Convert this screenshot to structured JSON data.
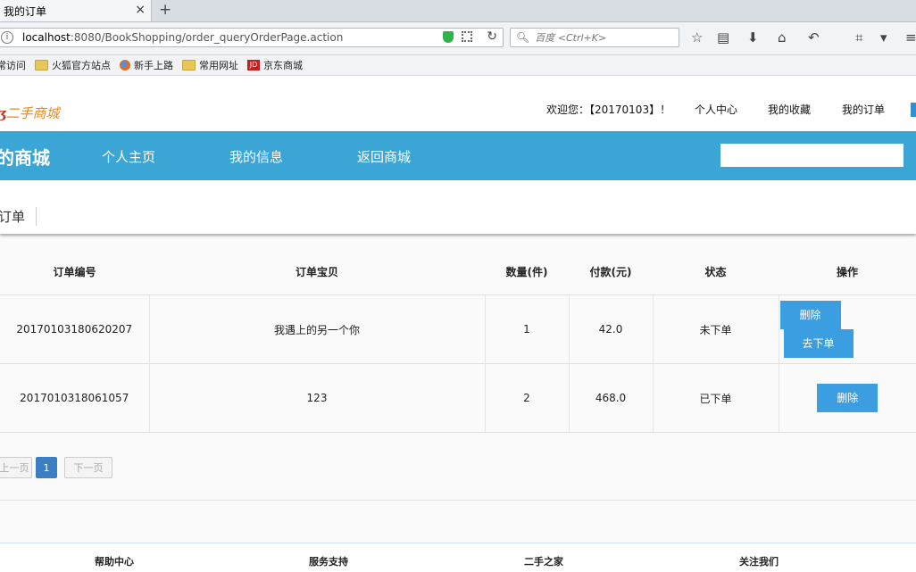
{
  "browser": {
    "tab_title": "我的订单",
    "tab_close": "×",
    "new_tab": "+",
    "url_host": "localhost",
    "url_rest": ":8080/BookShopping/order_queryOrderPage.action",
    "search_placeholder": "百度 <Ctrl+K>",
    "bookmarks": [
      "常访问",
      "火狐官方站点",
      "新手上路",
      "常用网址",
      "京东商城"
    ]
  },
  "header": {
    "logo_text": "二手商城",
    "welcome": "欢迎您：【20170103】！",
    "links": [
      "个人中心",
      "我的收藏",
      "我的订单"
    ]
  },
  "nav": {
    "brand": "的商城",
    "links": [
      "个人主页",
      "我的信息",
      "返回商城"
    ],
    "search_value": ""
  },
  "breadcrumb": "订单",
  "table": {
    "headers": [
      "订单编号",
      "订单宝贝",
      "数量(件)",
      "付款(元)",
      "状态",
      "操作"
    ],
    "rows": [
      {
        "id": "20170103180620207",
        "item": "我遇上的另一个你",
        "qty": "1",
        "pay": "42.0",
        "status": "未下单",
        "actions": [
          "删除",
          "去下单"
        ]
      },
      {
        "id": "2017010318061057",
        "item": "123",
        "qty": "2",
        "pay": "468.0",
        "status": "已下单",
        "actions": [
          "删除"
        ]
      }
    ]
  },
  "pager": {
    "prev": "上一页",
    "current": "1",
    "next": "下一页"
  },
  "footer": [
    "帮助中心",
    "服务支持",
    "二手之家",
    "关注我们"
  ]
}
